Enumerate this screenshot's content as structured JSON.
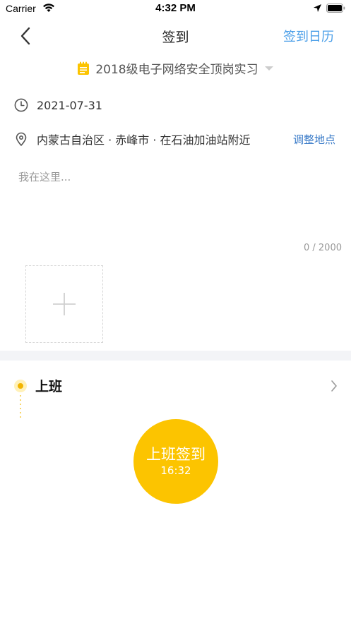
{
  "status_bar": {
    "carrier": "Carrier",
    "time": "4:32 PM"
  },
  "nav": {
    "title": "签到",
    "right_action": "签到日历"
  },
  "project": {
    "name": "2018级电子网络安全顶岗实习"
  },
  "date": "2021-07-31",
  "location": {
    "address": "内蒙古自治区 · 赤峰市 · 在石油加油站附近",
    "adjust_label": "调整地点"
  },
  "note": {
    "placeholder": "我在这里...",
    "value": "",
    "char_count": "0 / 2000"
  },
  "shift": {
    "title": "上班"
  },
  "checkin": {
    "label": "上班签到",
    "time": "16:32"
  },
  "colors": {
    "accent_yellow": "#fcc400",
    "link_blue": "#4a9ee8",
    "adjust_blue": "#3a7bc8",
    "divider_gray": "#f3f4f7"
  },
  "icons": {
    "back": "chevron-left-icon",
    "project": "notebook-icon",
    "date": "clock-icon",
    "location": "map-pin-icon",
    "add_photo": "plus-icon",
    "timeline": "dot-icon",
    "detail": "chevron-right-icon"
  }
}
